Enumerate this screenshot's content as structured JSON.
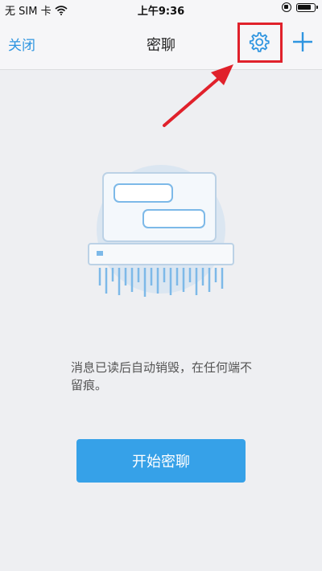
{
  "status_bar": {
    "carrier": "无 SIM 卡",
    "time": "上午9:36"
  },
  "nav": {
    "close_label": "关闭",
    "title": "密聊",
    "settings_icon": "gear-icon",
    "add_icon": "plus-icon"
  },
  "main": {
    "description": "消息已读后自动销毁，在任何端不留痕。",
    "start_button_label": "开始密聊"
  },
  "colors": {
    "accent": "#2f95e0",
    "button": "#36a1e8",
    "annotation": "#e0212b"
  }
}
